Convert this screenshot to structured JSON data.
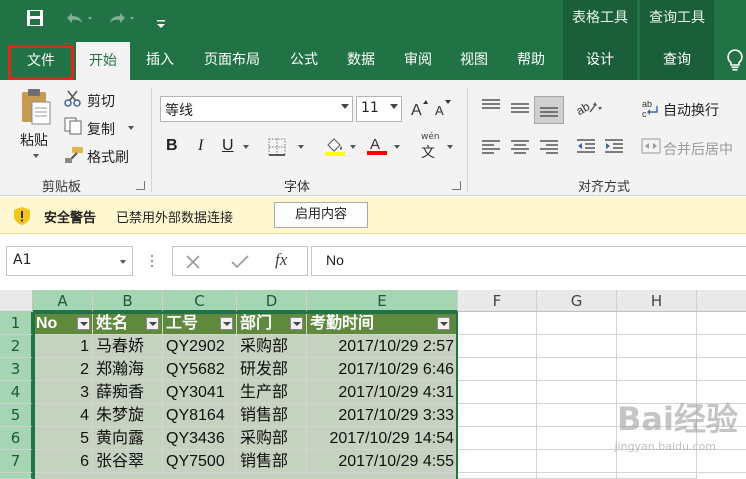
{
  "titlebar": {
    "context_table_tools": "表格工具",
    "context_query_tools": "查询工具"
  },
  "tabs": {
    "file": "文件",
    "home": "开始",
    "insert": "插入",
    "page_layout": "页面布局",
    "formulas": "公式",
    "data": "数据",
    "review": "审阅",
    "view": "视图",
    "help": "帮助",
    "design": "设计",
    "query": "查询"
  },
  "clipboard": {
    "paste": "粘贴",
    "cut": "剪切",
    "copy": "复制",
    "format_painter": "格式刷",
    "group_label": "剪贴板"
  },
  "font": {
    "font_name": "等线",
    "font_size": "11",
    "bold": "B",
    "italic": "I",
    "underline": "U",
    "phonetic": "wén",
    "phonetic_char": "文",
    "group_label": "字体",
    "fill_color": "#ffff00",
    "font_color": "#ff0000"
  },
  "alignment": {
    "wrap_text": "自动换行",
    "merge_center": "合并后居中",
    "group_label": "对齐方式"
  },
  "security": {
    "title": "安全警告",
    "message": "已禁用外部数据连接",
    "enable_button": "启用内容"
  },
  "formula_bar": {
    "name_box": "A1",
    "formula": "No"
  },
  "grid": {
    "columns": [
      "A",
      "B",
      "C",
      "D",
      "E",
      "F",
      "G",
      "H"
    ],
    "rows": [
      "1",
      "2",
      "3",
      "4",
      "5",
      "6",
      "7"
    ],
    "headers": [
      "No",
      "姓名",
      "工号",
      "部门",
      "考勤时间"
    ],
    "data": [
      [
        "1",
        "马春娇",
        "QY2902",
        "采购部",
        "2017/10/29 2:57"
      ],
      [
        "2",
        "郑瀚海",
        "QY5682",
        "研发部",
        "2017/10/29 6:46"
      ],
      [
        "3",
        "薛痴香",
        "QY3041",
        "生产部",
        "2017/10/29 4:31"
      ],
      [
        "4",
        "朱梦旋",
        "QY8164",
        "销售部",
        "2017/10/29 3:33"
      ],
      [
        "5",
        "黄向露",
        "QY3436",
        "采购部",
        "2017/10/29 14:54"
      ],
      [
        "6",
        "张谷翠",
        "QY7500",
        "销售部",
        "2017/10/29 4:55"
      ]
    ]
  },
  "watermark": {
    "logo": "Bai经验",
    "url": "jingyan.baidu.com"
  },
  "colors": {
    "accent": "#217346",
    "table_header": "#5f8a3e",
    "table_body": "#c6d2c0",
    "highlight_outline": "#d72b20"
  }
}
